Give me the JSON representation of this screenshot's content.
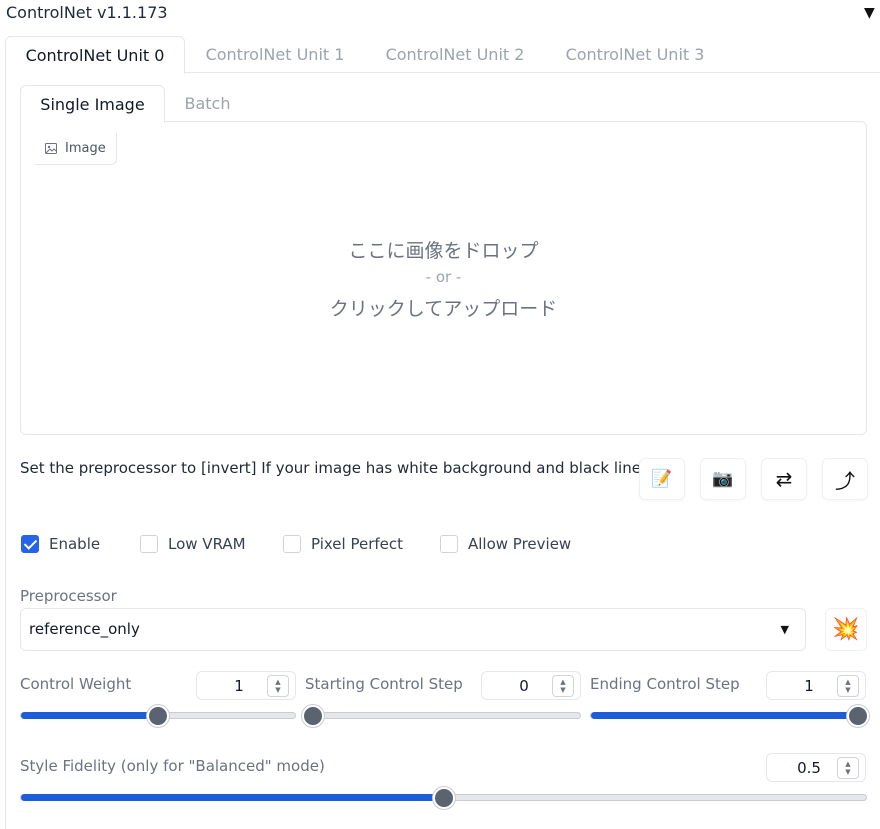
{
  "header": {
    "title": "ControlNet v1.1.173",
    "caret": "▼"
  },
  "unit_tabs": [
    "ControlNet Unit 0",
    "ControlNet Unit 1",
    "ControlNet Unit 2",
    "ControlNet Unit 3"
  ],
  "image_tabs": [
    "Single Image",
    "Batch"
  ],
  "image_upload": {
    "label": "Image",
    "drop_text": "ここに画像をドロップ",
    "or_text": "- or -",
    "click_text": "クリックしてアップロード"
  },
  "hint": "Set the preprocessor to [invert] If your image has white background and black lines.",
  "tool_buttons": [
    {
      "name": "edit-icon",
      "glyph": "📝"
    },
    {
      "name": "camera-icon",
      "glyph": "📷"
    },
    {
      "name": "swap-icon",
      "glyph": "⇄"
    },
    {
      "name": "send-icon",
      "glyph": "⤴"
    }
  ],
  "checkboxes": [
    {
      "label": "Enable",
      "checked": true
    },
    {
      "label": "Low VRAM",
      "checked": false
    },
    {
      "label": "Pixel Perfect",
      "checked": false
    },
    {
      "label": "Allow Preview",
      "checked": false
    }
  ],
  "preprocessor": {
    "label": "Preprocessor",
    "value": "reference_only",
    "run_icon": "💥"
  },
  "sliders": {
    "control_weight": {
      "label": "Control Weight",
      "value": "1",
      "fraction": 0.5
    },
    "starting_step": {
      "label": "Starting Control Step",
      "value": "0",
      "fraction": 0.0
    },
    "ending_step": {
      "label": "Ending Control Step",
      "value": "1",
      "fraction": 1.0
    },
    "style_fidelity": {
      "label": "Style Fidelity (only for \"Balanced\" mode)",
      "value": "0.5",
      "fraction": 0.5
    }
  },
  "colors": {
    "accent": "#1d5ed8",
    "thumb": "#5b6270",
    "border": "#e5e7eb"
  }
}
